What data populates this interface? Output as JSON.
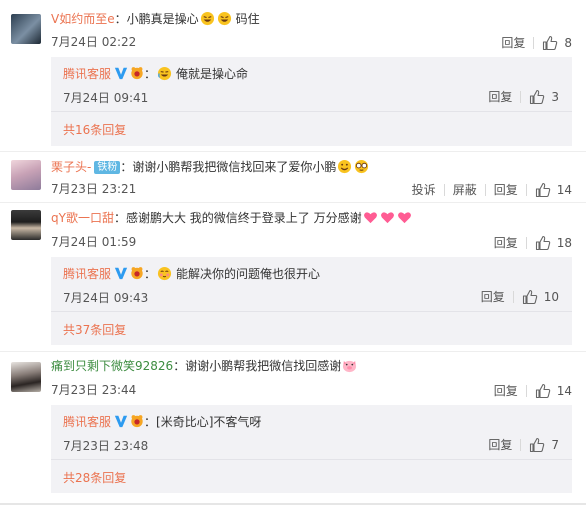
{
  "comments": [
    {
      "user": "V如约而至e",
      "text": "小鹏真是操心",
      "text_after": "码住",
      "time": "7月24日 02:22",
      "reply_label": "回复",
      "likes": "8",
      "reply": {
        "user": "腾讯客服",
        "text": "俺就是操心命",
        "time": "7月24日 09:41",
        "reply_label": "回复",
        "likes": "3",
        "more": "共16条回复"
      }
    },
    {
      "user": "栗子头-",
      "badge": "铁粉",
      "text": "谢谢小鹏帮我把微信找回来了爱你小鹏",
      "time": "7月23日 23:21",
      "report_label": "投诉",
      "block_label": "屏蔽",
      "reply_label": "回复",
      "likes": "14"
    },
    {
      "user": "qY歌一口甜",
      "text": "感谢鹏大大  我的微信终于登录上了  万分感谢",
      "time": "7月24日 01:59",
      "reply_label": "回复",
      "likes": "18",
      "reply": {
        "user": "腾讯客服",
        "text": "能解决你的问题俺也很开心",
        "time": "7月24日 09:43",
        "reply_label": "回复",
        "likes": "10",
        "more": "共37条回复"
      }
    },
    {
      "user": "痛到只剩下微笑92826",
      "text": "谢谢小鹏帮我把微信找回感谢",
      "time": "7月23日 23:44",
      "reply_label": "回复",
      "likes": "14",
      "reply": {
        "user": "腾讯客服",
        "text": "[米奇比心]不客气呀",
        "time": "7月23日 23:48",
        "reply_label": "回复",
        "likes": "7",
        "more": "共28条回复"
      }
    }
  ],
  "colors": {
    "username": "#eb7350",
    "username_alt": "#3d8c40",
    "reply_bg": "#f2f2f5",
    "verified_blue": "#2d9bf0",
    "fan_badge": "#5fb7e3"
  },
  "icons": {
    "like": "thumbs-up-icon",
    "verified": "verified-v-icon",
    "fan": "fan-badge-icon"
  }
}
